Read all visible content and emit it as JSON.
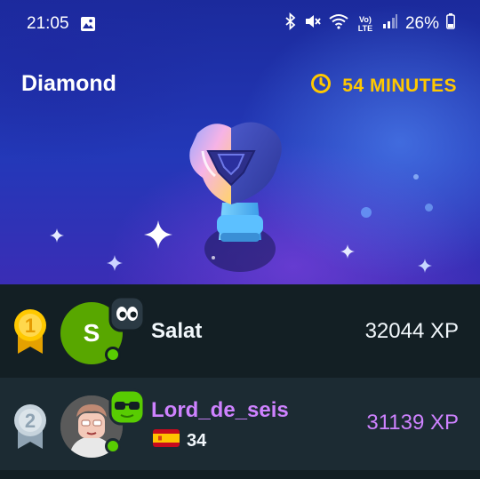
{
  "status_bar": {
    "time": "21:05",
    "battery": "26%",
    "volte": "Vo) LTE",
    "icons": [
      "gallery-icon",
      "bluetooth-icon",
      "mute-icon",
      "wifi-icon",
      "signal-icon",
      "battery-icon"
    ]
  },
  "header": {
    "league": "Diamond",
    "time_left": "54 MINUTES",
    "timer_icon": "clock-icon",
    "accent_color": "#ffc800"
  },
  "leaderboard": [
    {
      "rank": "1",
      "avatar_letter": "S",
      "avatar_color": "#58a700",
      "name": "Salat",
      "xp": "32044 XP",
      "badge_icon": "eyes-face-icon",
      "name_color": "#f1f7fb"
    },
    {
      "rank": "2",
      "name": "Lord_de_seis",
      "xp": "31139 XP",
      "flag_icon": "spain-flag-icon",
      "streak": "34",
      "badge_icon": "sunglasses-face-icon",
      "name_color": "#ce82ff"
    }
  ]
}
